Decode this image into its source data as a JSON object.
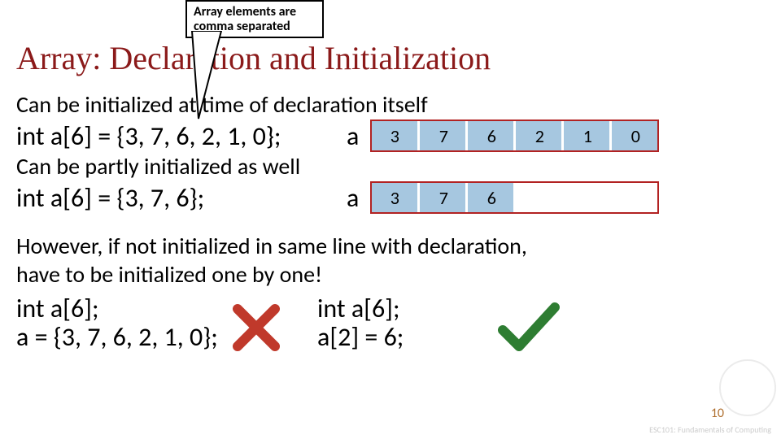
{
  "callout": {
    "line1": "Array elements are",
    "line2": "comma separated"
  },
  "title": "Array: Declaration and Initialization",
  "lines": {
    "p1": "Can be initialized at time of declaration itself",
    "code1": "int a[6] = {3, 7, 6, 2, 1, 0};",
    "p2": "Can be partly initialized as well",
    "code2": "int a[6] = {3, 7, 6};",
    "p3a": "However, if not initialized in same line with declaration,",
    "p3b": "have to be initialized one by one!",
    "wrong1": "int a[6];",
    "wrong2": "a = {3, 7, 6, 2, 1, 0};",
    "right1": "int a[6];",
    "right2": "a[2] = 6;"
  },
  "arrays": {
    "label": "a",
    "a1": [
      "3",
      "7",
      "6",
      "2",
      "1",
      "0"
    ],
    "a1_filled": [
      true,
      true,
      true,
      true,
      true,
      true
    ],
    "a2": [
      "3",
      "7",
      "6",
      "",
      "",
      ""
    ],
    "a2_filled": [
      true,
      true,
      true,
      false,
      false,
      false
    ]
  },
  "page_number": "10",
  "footer": "ESC101: Fundamentals\nof Computing"
}
